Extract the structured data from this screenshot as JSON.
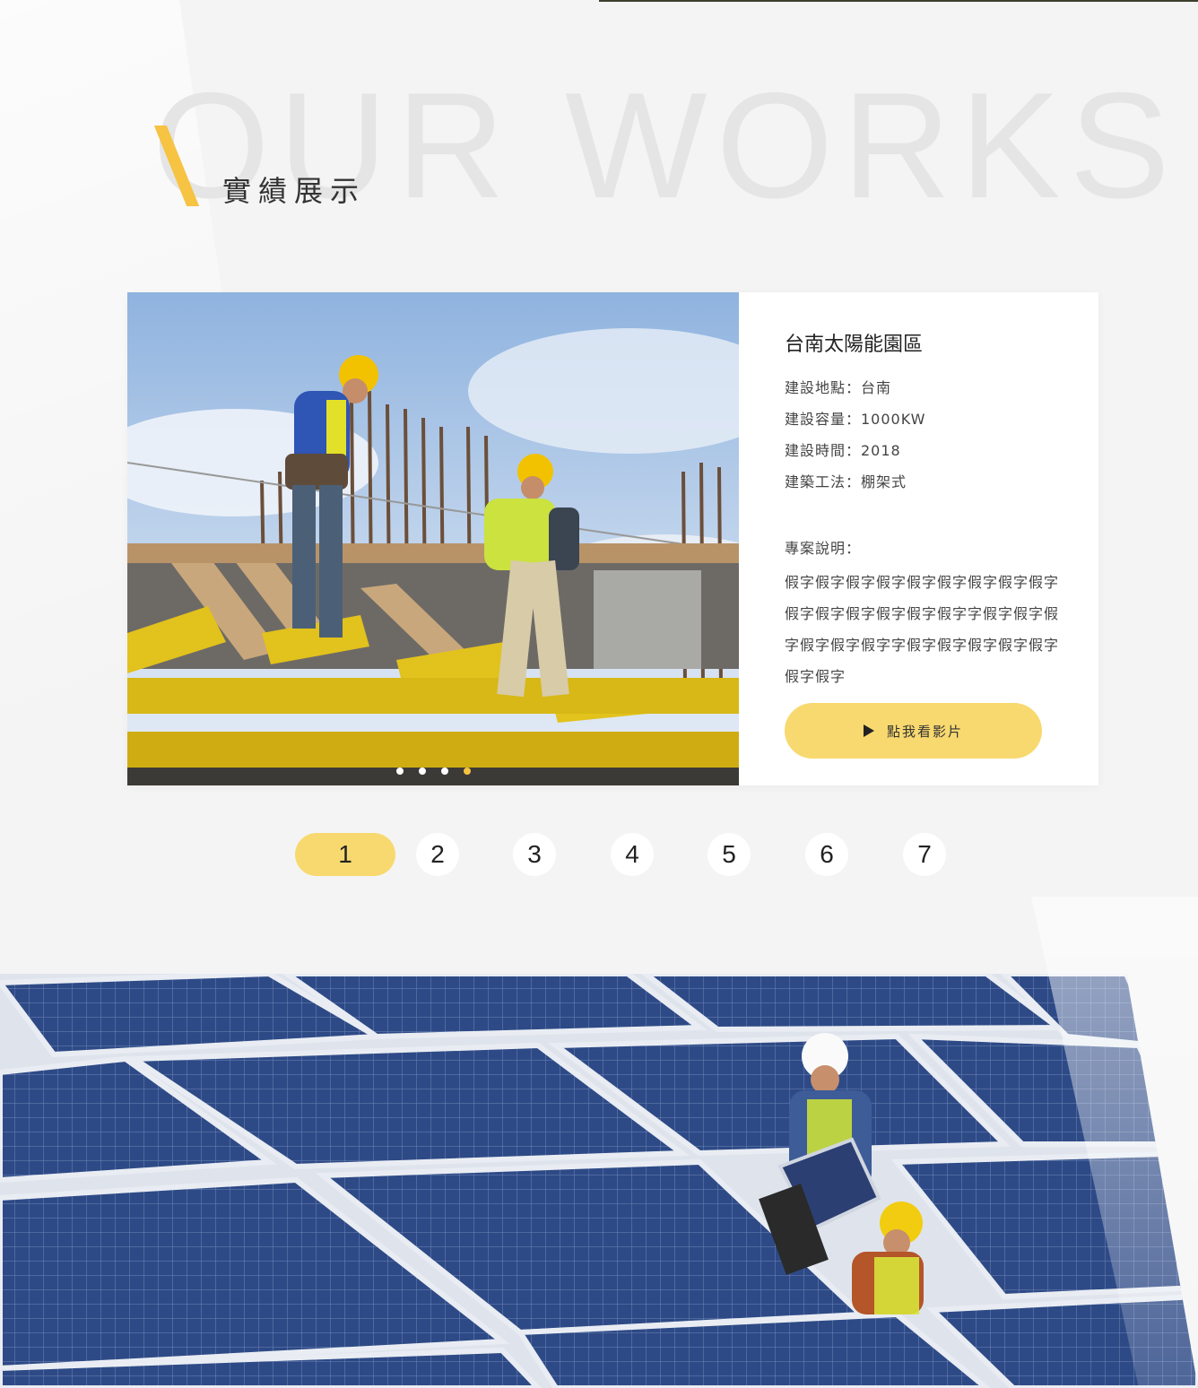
{
  "section": {
    "bg_word": "OUR WORKS",
    "title": "實績展示",
    "accent_color": "#f6c342"
  },
  "project": {
    "title": "台南太陽能園區",
    "meta": [
      "建設地點：台南",
      "建設容量：1000KW",
      "建設時間：2018",
      "建築工法：棚架式"
    ],
    "desc_label": "專案說明：",
    "description": "假字假字假字假字假字假字假字假字假字假字假字假字假字假字假字字假字假字假字假字假字假字字假字假字假字假字假字假字假字",
    "video_button": "點我看影片",
    "video_icon": "play-icon",
    "button_color": "#f8d96f"
  },
  "slider": {
    "dot_count": 4,
    "active_dot": 4
  },
  "pagination": {
    "pages": [
      "1",
      "2",
      "3",
      "4",
      "5",
      "6",
      "7"
    ],
    "active": "1"
  }
}
